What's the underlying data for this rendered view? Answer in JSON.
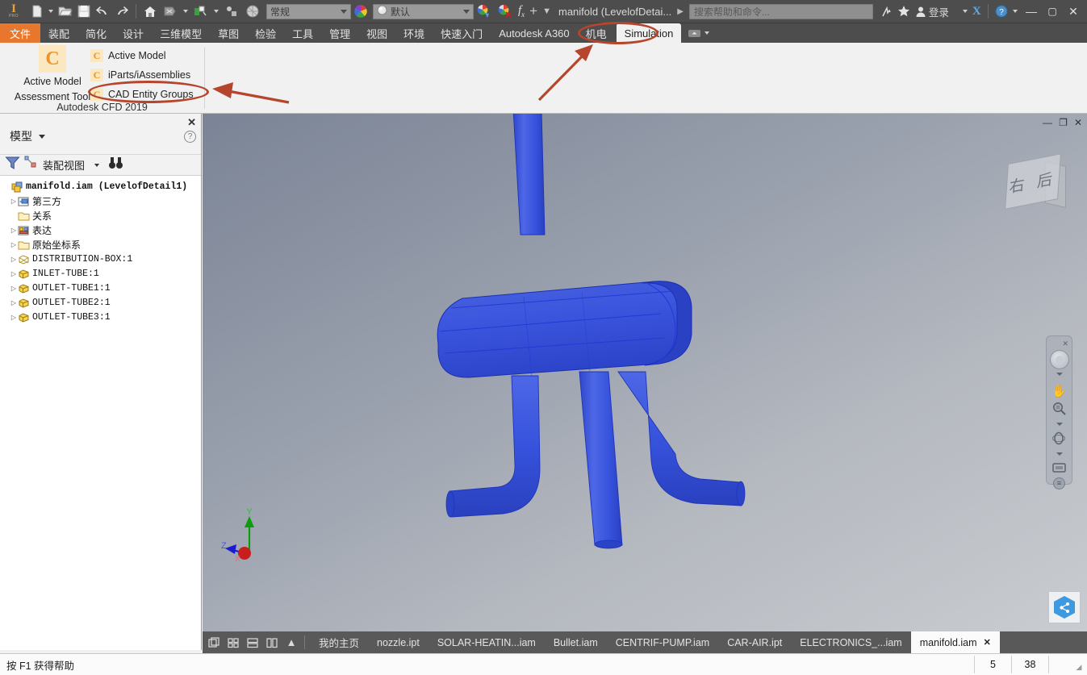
{
  "titlebar": {
    "app_logo": "inventor-logo",
    "quick_access": [
      {
        "name": "new-file",
        "icon": "document-icon"
      },
      {
        "name": "open-file",
        "icon": "folder-open-icon"
      },
      {
        "name": "save-file",
        "icon": "floppy-disk-icon"
      },
      {
        "name": "undo",
        "icon": "undo-arrow-icon"
      },
      {
        "name": "redo",
        "icon": "redo-arrow-icon"
      },
      {
        "name": "home",
        "icon": "home-icon"
      },
      {
        "name": "return",
        "icon": "return-icon"
      },
      {
        "name": "appearance",
        "icon": "paint-icon"
      },
      {
        "name": "material",
        "icon": "material-icon"
      },
      {
        "name": "sphere",
        "icon": "sphere-icon"
      }
    ],
    "material_combo": "常规",
    "appearance_combo": "默认",
    "document_title": "manifold (LevelofDetai...",
    "search_placeholder": "搜索帮助和命令...",
    "sign_in": "登录",
    "exchange_label": "X",
    "help_label": "?",
    "window_buttons": {
      "minimize": "—",
      "maximize": "▢",
      "close": "✕"
    }
  },
  "ribbon_tabs": [
    {
      "label": "文件",
      "kind": "file"
    },
    {
      "label": "装配",
      "kind": "normal"
    },
    {
      "label": "简化",
      "kind": "normal"
    },
    {
      "label": "设计",
      "kind": "normal"
    },
    {
      "label": "三维模型",
      "kind": "normal"
    },
    {
      "label": "草图",
      "kind": "normal"
    },
    {
      "label": "检验",
      "kind": "normal"
    },
    {
      "label": "工具",
      "kind": "normal"
    },
    {
      "label": "管理",
      "kind": "normal"
    },
    {
      "label": "视图",
      "kind": "normal"
    },
    {
      "label": "环境",
      "kind": "normal"
    },
    {
      "label": "快速入门",
      "kind": "normal"
    },
    {
      "label": "Autodesk A360",
      "kind": "normal"
    },
    {
      "label": "机电",
      "kind": "normal"
    },
    {
      "label": "Simulation",
      "kind": "active"
    }
  ],
  "ribbon_panel": {
    "big_button": {
      "icon_letter": "C",
      "line1": "Active Model",
      "line2": "Assessment Tool"
    },
    "menu_items": [
      {
        "icon_letter": "C",
        "label": "Active Model"
      },
      {
        "icon_letter": "C",
        "label": "iParts/iAssemblies"
      },
      {
        "icon_letter": "C",
        "label": "CAD Entity Groups",
        "highlighted": true
      }
    ],
    "panel_title": "Autodesk CFD 2019"
  },
  "browser": {
    "close": "✕",
    "title": "模型",
    "help": "?",
    "toolbar": {
      "filter_icon": "filter-funnel-icon",
      "view_icon": "assembly-view-icon",
      "view_label": "装配视图",
      "find_icon": "binoculars-icon"
    },
    "tree": [
      {
        "label": "manifold.iam (LevelofDetail1)",
        "icon": "assembly-icon",
        "indent": 0,
        "expandable": false,
        "root": true
      },
      {
        "label": "第三方",
        "icon": "third-party-icon",
        "indent": 1,
        "expandable": true,
        "cjk": true
      },
      {
        "label": "关系",
        "icon": "folder-icon",
        "indent": 1,
        "expandable": false,
        "cjk": true
      },
      {
        "label": "表达",
        "icon": "representation-icon",
        "indent": 1,
        "expandable": true,
        "cjk": true
      },
      {
        "label": "原始坐标系",
        "icon": "folder-icon",
        "indent": 1,
        "expandable": true,
        "cjk": true
      },
      {
        "label": "DISTRIBUTION-BOX:1",
        "icon": "part-hidden-icon",
        "indent": 1,
        "expandable": true
      },
      {
        "label": "INLET-TUBE:1",
        "icon": "part-icon",
        "indent": 1,
        "expandable": true
      },
      {
        "label": "OUTLET-TUBE1:1",
        "icon": "part-icon",
        "indent": 1,
        "expandable": true
      },
      {
        "label": "OUTLET-TUBE2:1",
        "icon": "part-icon",
        "indent": 1,
        "expandable": true
      },
      {
        "label": "OUTLET-TUBE3:1",
        "icon": "part-icon",
        "indent": 1,
        "expandable": true
      }
    ]
  },
  "viewport": {
    "window_buttons": {
      "minimize": "—",
      "restore": "❐",
      "close": "✕"
    },
    "viewcube_label": "右 后",
    "nav_tools": [
      {
        "name": "steering-wheel",
        "icon": "wheel-icon"
      },
      {
        "name": "pan",
        "icon": "hand-icon"
      },
      {
        "name": "zoom",
        "icon": "magnifier-icon"
      },
      {
        "name": "orbit",
        "icon": "orbit-icon"
      },
      {
        "name": "look-at",
        "icon": "screen-icon"
      }
    ],
    "axes": {
      "x": "X",
      "y": "Y",
      "z": "Z"
    },
    "model_color": "#3355dd",
    "model_edge_color": "#1a33cc",
    "a360_icon": "share-hexagon-icon"
  },
  "doc_tabs": {
    "view_icons": [
      "tile-icon",
      "grid-icon",
      "horizontal-icon",
      "vertical-icon",
      "collapse-icon"
    ],
    "tabs": [
      {
        "label": "我的主页",
        "active": false,
        "closable": false
      },
      {
        "label": "nozzle.ipt",
        "active": false,
        "closable": false
      },
      {
        "label": "SOLAR-HEATIN...iam",
        "active": false,
        "closable": false
      },
      {
        "label": "Bullet.iam",
        "active": false,
        "closable": false
      },
      {
        "label": "CENTRIF-PUMP.iam",
        "active": false,
        "closable": false
      },
      {
        "label": "CAR-AIR.ipt",
        "active": false,
        "closable": false
      },
      {
        "label": "ELECTRONICS_...iam",
        "active": false,
        "closable": false
      },
      {
        "label": "manifold.iam",
        "active": true,
        "closable": true,
        "close": "✕"
      }
    ]
  },
  "statusbar": {
    "hint": "按 F1 获得帮助",
    "cell1": "5",
    "cell2": "38"
  },
  "annotations": {
    "accent_color": "#b5452c",
    "callouts": [
      "simulation-tab-ellipse",
      "cad-entity-groups-ellipse"
    ],
    "arrows": [
      "arrow-to-simulation-tab",
      "arrow-to-cad-entity-groups"
    ]
  }
}
